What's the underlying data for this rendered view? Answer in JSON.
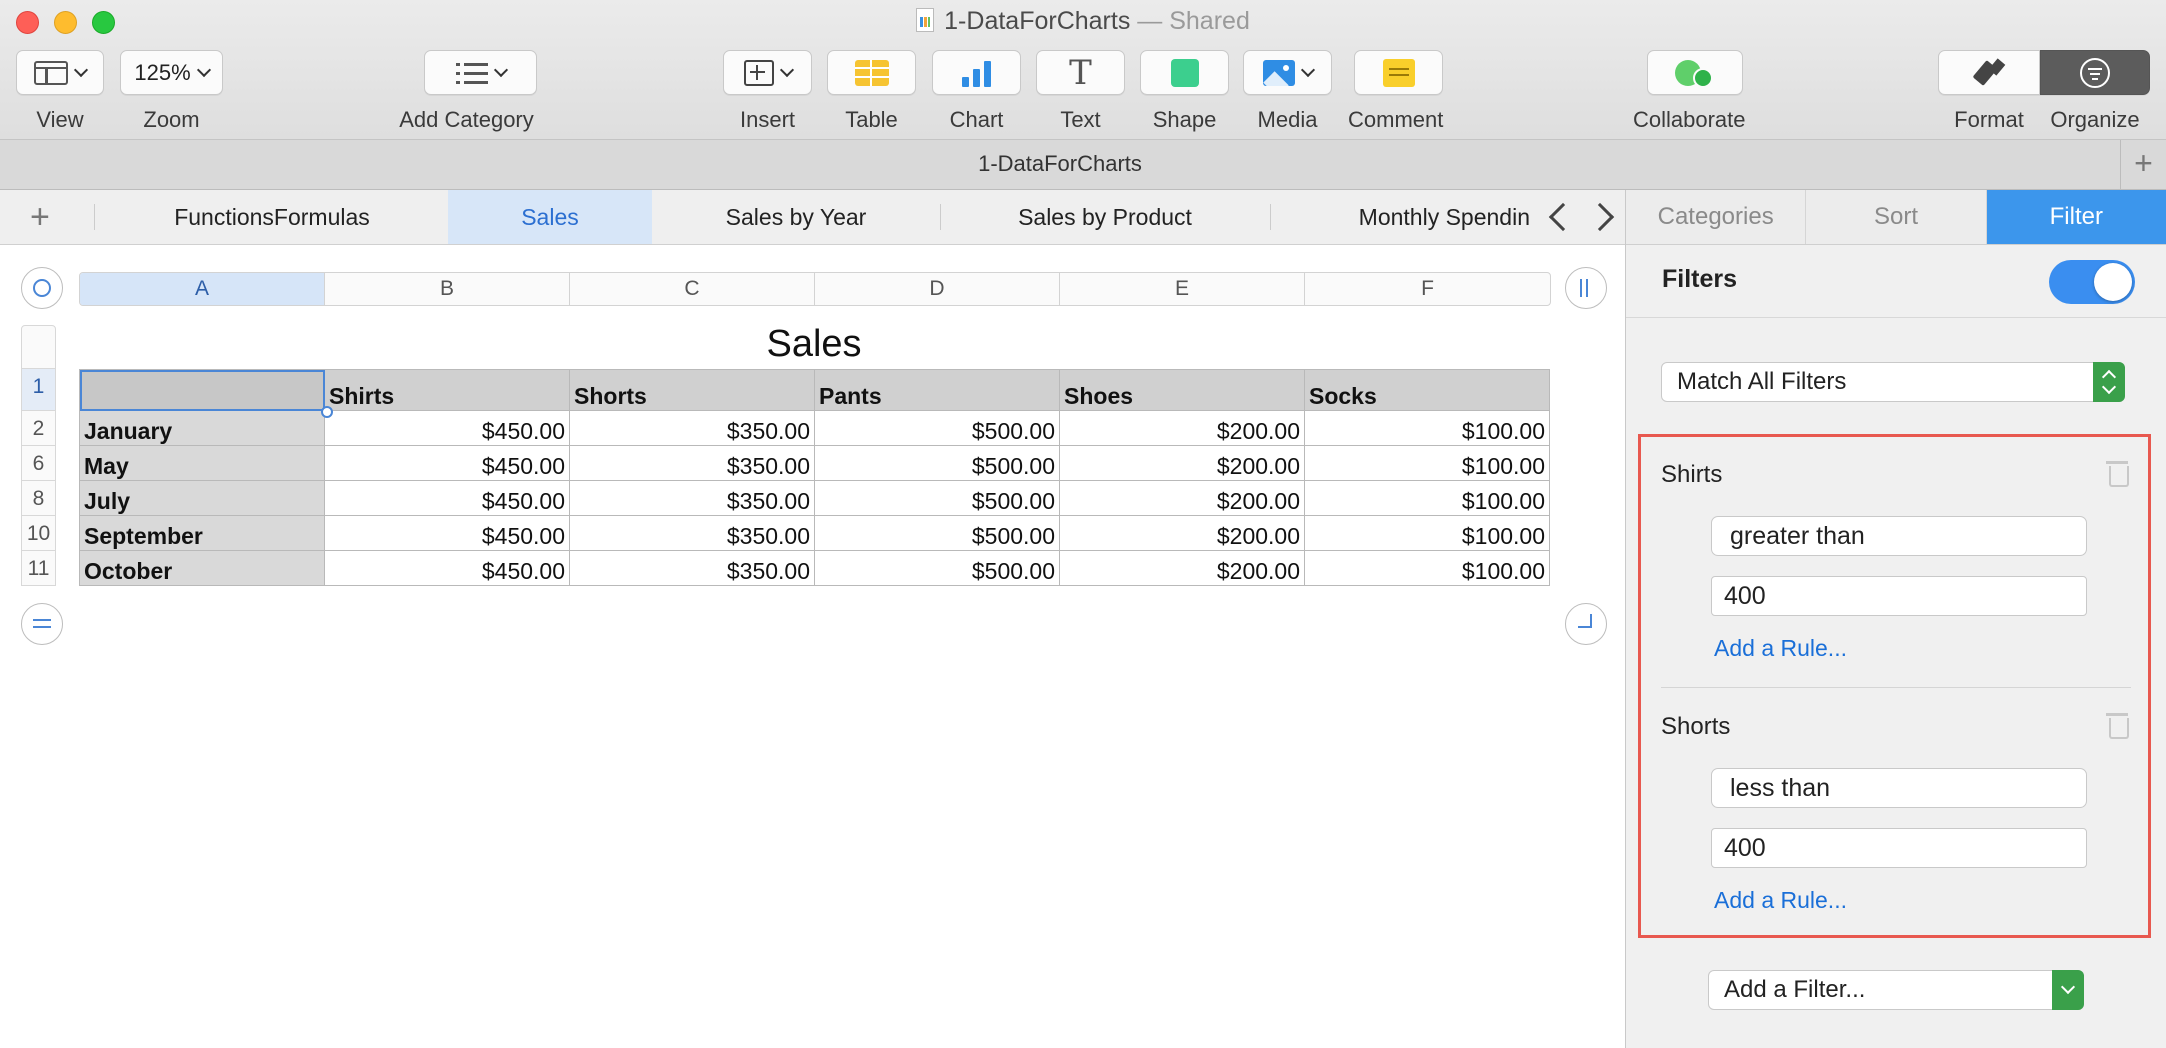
{
  "window": {
    "title": "1-DataForCharts",
    "shared_suffix": "— Shared"
  },
  "toolbar": {
    "view_label": "View",
    "zoom_value": "125%",
    "zoom_label": "Zoom",
    "add_category_label": "Add Category",
    "insert_label": "Insert",
    "table_label": "Table",
    "chart_label": "Chart",
    "text_label": "Text",
    "text_icon_glyph": "T",
    "shape_label": "Shape",
    "media_label": "Media",
    "comment_label": "Comment",
    "collaborate_label": "Collaborate",
    "format_label": "Format",
    "organize_label": "Organize"
  },
  "document_tab": {
    "title": "1-DataForCharts",
    "add_glyph": "+"
  },
  "sheet_tabs": {
    "add_glyph": "+",
    "tabs": [
      {
        "label": "FunctionsFormulas"
      },
      {
        "label": "Sales"
      },
      {
        "label": "Sales by Year"
      },
      {
        "label": "Sales by Product"
      },
      {
        "label": "Monthly Spendin"
      }
    ],
    "active_index": 1
  },
  "sheet": {
    "column_headers": [
      "A",
      "B",
      "C",
      "D",
      "E",
      "F"
    ],
    "row_numbers": [
      "1",
      "2",
      "6",
      "8",
      "10",
      "11"
    ],
    "table_title": "Sales",
    "table_header": [
      "",
      "Shirts",
      "Shorts",
      "Pants",
      "Shoes",
      "Socks"
    ],
    "rows": [
      {
        "label": "January",
        "values": [
          "$450.00",
          "$350.00",
          "$500.00",
          "$200.00",
          "$100.00"
        ]
      },
      {
        "label": "May",
        "values": [
          "$450.00",
          "$350.00",
          "$500.00",
          "$200.00",
          "$100.00"
        ]
      },
      {
        "label": "July",
        "values": [
          "$450.00",
          "$350.00",
          "$500.00",
          "$200.00",
          "$100.00"
        ]
      },
      {
        "label": "September",
        "values": [
          "$450.00",
          "$350.00",
          "$500.00",
          "$200.00",
          "$100.00"
        ]
      },
      {
        "label": "October",
        "values": [
          "$450.00",
          "$350.00",
          "$500.00",
          "$200.00",
          "$100.00"
        ]
      }
    ]
  },
  "inspector": {
    "tabs": [
      "Categories",
      "Sort",
      "Filter"
    ],
    "active_tab": "Filter",
    "filters_label": "Filters",
    "filters_enabled": true,
    "match_mode": "Match All Filters",
    "rules": [
      {
        "column": "Shirts",
        "condition": "greater than",
        "value": "400",
        "add_rule": "Add a Rule..."
      },
      {
        "column": "Shorts",
        "condition": "less than",
        "value": "400",
        "add_rule": "Add a Rule..."
      }
    ],
    "add_filter_label": "Add a Filter...",
    "highlight_color": "#e8584f",
    "accent_color": "#3c96ec"
  }
}
